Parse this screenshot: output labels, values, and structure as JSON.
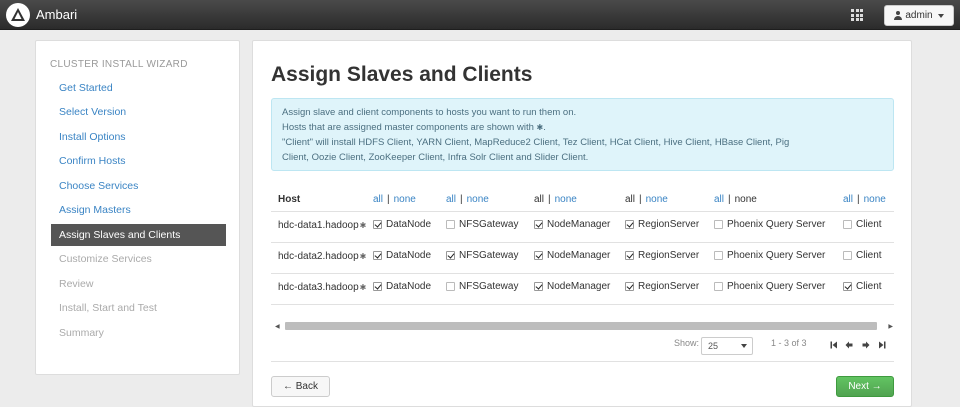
{
  "header": {
    "brand": "Ambari",
    "user_menu_label": "admin"
  },
  "sidebar": {
    "title": "CLUSTER INSTALL WIZARD",
    "steps": [
      {
        "label": "Get Started",
        "state": "done"
      },
      {
        "label": "Select Version",
        "state": "done"
      },
      {
        "label": "Install Options",
        "state": "done"
      },
      {
        "label": "Confirm Hosts",
        "state": "done"
      },
      {
        "label": "Choose Services",
        "state": "done"
      },
      {
        "label": "Assign Masters",
        "state": "done"
      },
      {
        "label": "Assign Slaves and Clients",
        "state": "active"
      },
      {
        "label": "Customize Services",
        "state": "disabled"
      },
      {
        "label": "Review",
        "state": "disabled"
      },
      {
        "label": "Install, Start and Test",
        "state": "disabled"
      },
      {
        "label": "Summary",
        "state": "disabled"
      }
    ]
  },
  "main": {
    "title": "Assign Slaves and Clients",
    "info": {
      "line1": "Assign slave and client components to hosts you want to run them on.",
      "line2": "Hosts that are assigned master components are shown with",
      "line2_glyph": "✱",
      "line2_end": ".",
      "line3": "\"Client\" will install HDFS Client, YARN Client, MapReduce2 Client, Tez Client, HCat Client, Hive Client, HBase Client, Pig",
      "line4": "Client, Oozie Client, ZooKeeper Client, Infra Solr Client and Slider Client."
    },
    "table": {
      "host_header": "Host",
      "all_label": "all",
      "none_label": "none",
      "pipe": "|",
      "column_headers": [
        {
          "all_link": true,
          "none_link": true
        },
        {
          "all_link": true,
          "none_link": true
        },
        {
          "all_link": false,
          "none_link": true
        },
        {
          "all_link": false,
          "none_link": true
        },
        {
          "all_link": true,
          "none_link": false
        },
        {
          "all_link": true,
          "none_link": true
        }
      ],
      "host_glyph": "✱",
      "rows": [
        {
          "host": "hdc-data1.hadoop",
          "components": [
            {
              "label": "DataNode",
              "checked": true
            },
            {
              "label": "NFSGateway",
              "checked": false
            },
            {
              "label": "NodeManager",
              "checked": true
            },
            {
              "label": "RegionServer",
              "checked": true
            },
            {
              "label": "Phoenix Query Server",
              "checked": false
            },
            {
              "label": "Client",
              "checked": false
            }
          ]
        },
        {
          "host": "hdc-data2.hadoop",
          "components": [
            {
              "label": "DataNode",
              "checked": true
            },
            {
              "label": "NFSGateway",
              "checked": true
            },
            {
              "label": "NodeManager",
              "checked": true
            },
            {
              "label": "RegionServer",
              "checked": true
            },
            {
              "label": "Phoenix Query Server",
              "checked": false
            },
            {
              "label": "Client",
              "checked": false
            }
          ]
        },
        {
          "host": "hdc-data3.hadoop",
          "components": [
            {
              "label": "DataNode",
              "checked": true
            },
            {
              "label": "NFSGateway",
              "checked": false
            },
            {
              "label": "NodeManager",
              "checked": true
            },
            {
              "label": "RegionServer",
              "checked": true
            },
            {
              "label": "Phoenix Query Server",
              "checked": false
            },
            {
              "label": "Client",
              "checked": true
            }
          ]
        }
      ]
    },
    "pagination": {
      "show_label": "Show:",
      "page_size": "25",
      "range_text": "1 - 3 of 3"
    },
    "buttons": {
      "back": "← Back",
      "next": "Next →"
    }
  },
  "colors": {
    "link": "#3a84c4",
    "active_step_bg": "#555555",
    "next_button": "#51a351",
    "info_bg": "#dff4fa"
  }
}
